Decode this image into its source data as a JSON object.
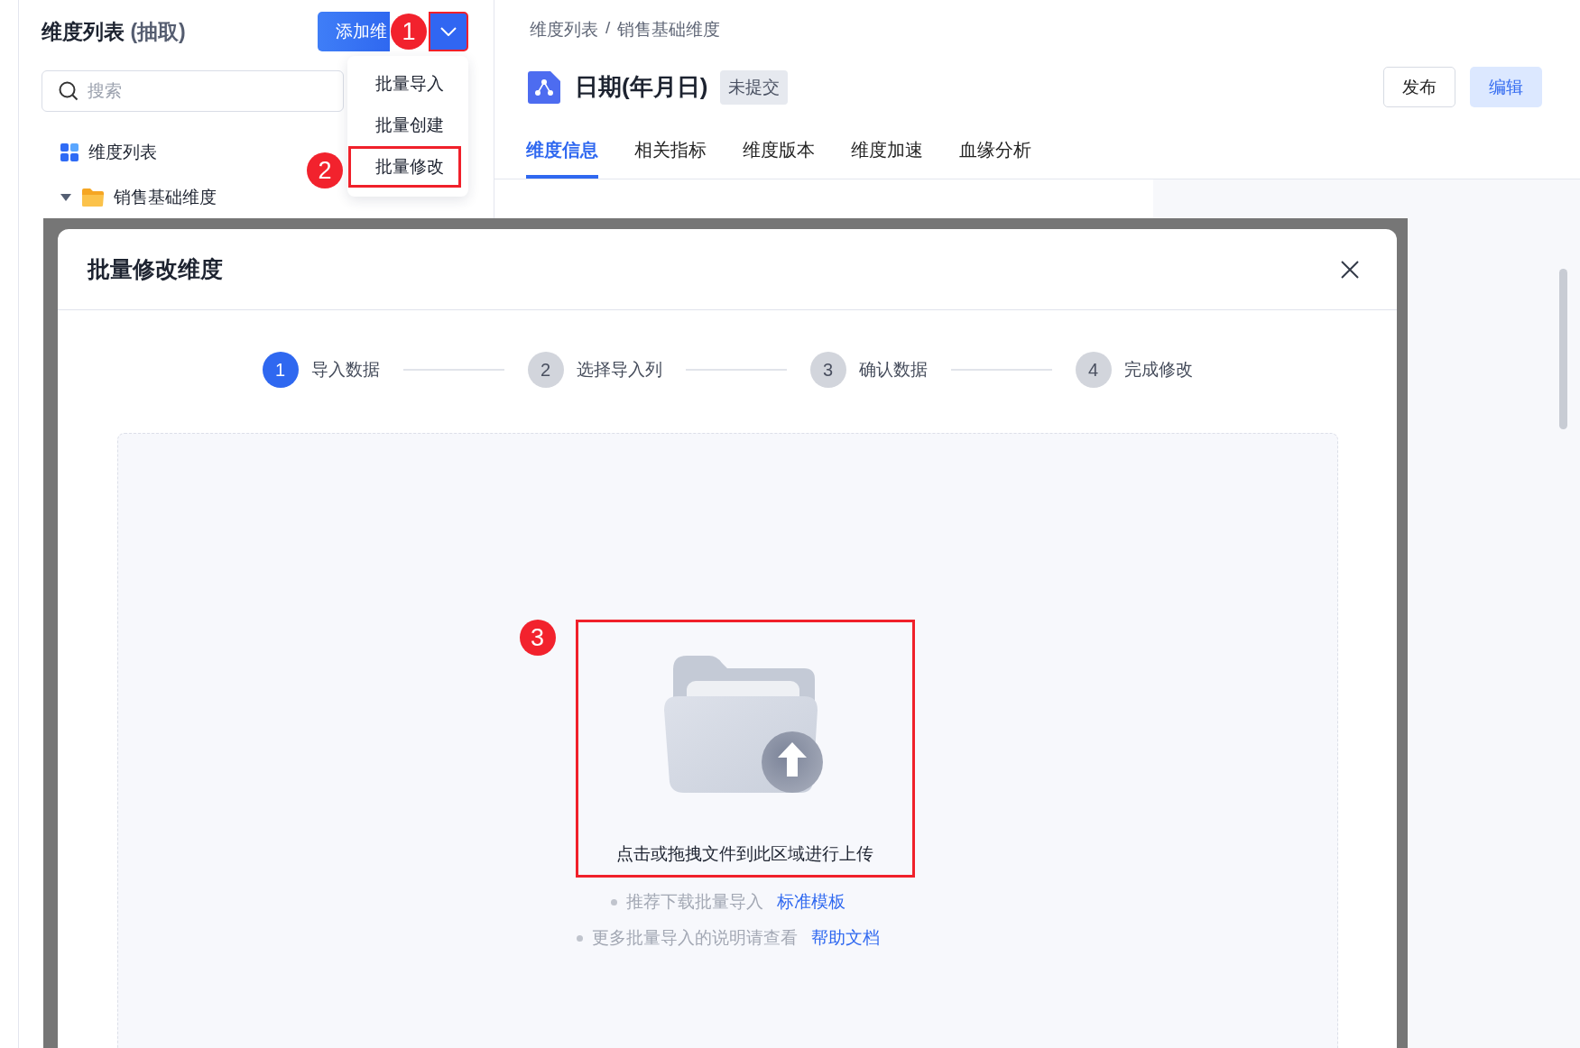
{
  "left_panel": {
    "title": "维度列表",
    "title_suffix": "(抽取)",
    "add_button": {
      "label": "添加维"
    },
    "dropdown_toggle": {
      "highlighted": true,
      "callout": "1"
    },
    "search": {
      "placeholder": "搜索"
    },
    "tree": [
      {
        "label": "维度列表",
        "kind": "list"
      },
      {
        "label": "销售基础维度",
        "kind": "folder",
        "expanded": true
      }
    ]
  },
  "dropdown_menu": {
    "items": [
      {
        "label": "批量导入",
        "highlighted": false
      },
      {
        "label": "批量创建",
        "highlighted": false
      },
      {
        "label": "批量修改",
        "highlighted": true,
        "callout": "2"
      }
    ]
  },
  "breadcrumb": {
    "items": [
      "维度列表",
      "销售基础维度"
    ],
    "separator": "/"
  },
  "dimension": {
    "name": "日期(年月日)",
    "status": "未提交"
  },
  "actions": [
    {
      "label": "发布",
      "kind": "secondary"
    },
    {
      "label": "编辑",
      "kind": "primary"
    }
  ],
  "tabs": [
    {
      "label": "维度信息",
      "selected": true
    },
    {
      "label": "相关指标",
      "selected": false
    },
    {
      "label": "维度版本",
      "selected": false
    },
    {
      "label": "维度加速",
      "selected": false
    },
    {
      "label": "血缘分析",
      "selected": false
    }
  ],
  "dialog": {
    "title": "批量修改维度",
    "steps": [
      {
        "number": "1",
        "label": "导入数据",
        "selected": true
      },
      {
        "number": "2",
        "label": "选择导入列",
        "selected": false
      },
      {
        "number": "3",
        "label": "确认数据",
        "selected": false
      },
      {
        "number": "4",
        "label": "完成修改",
        "selected": false
      }
    ],
    "upload": {
      "text": "点击或拖拽文件到此区域进行上传",
      "highlighted": true,
      "callout": "3"
    },
    "hints": [
      {
        "text": "推荐下载批量导入",
        "link": "标准模板"
      },
      {
        "text": "更多批量导入的说明请查看",
        "link": "帮助文档"
      }
    ]
  }
}
